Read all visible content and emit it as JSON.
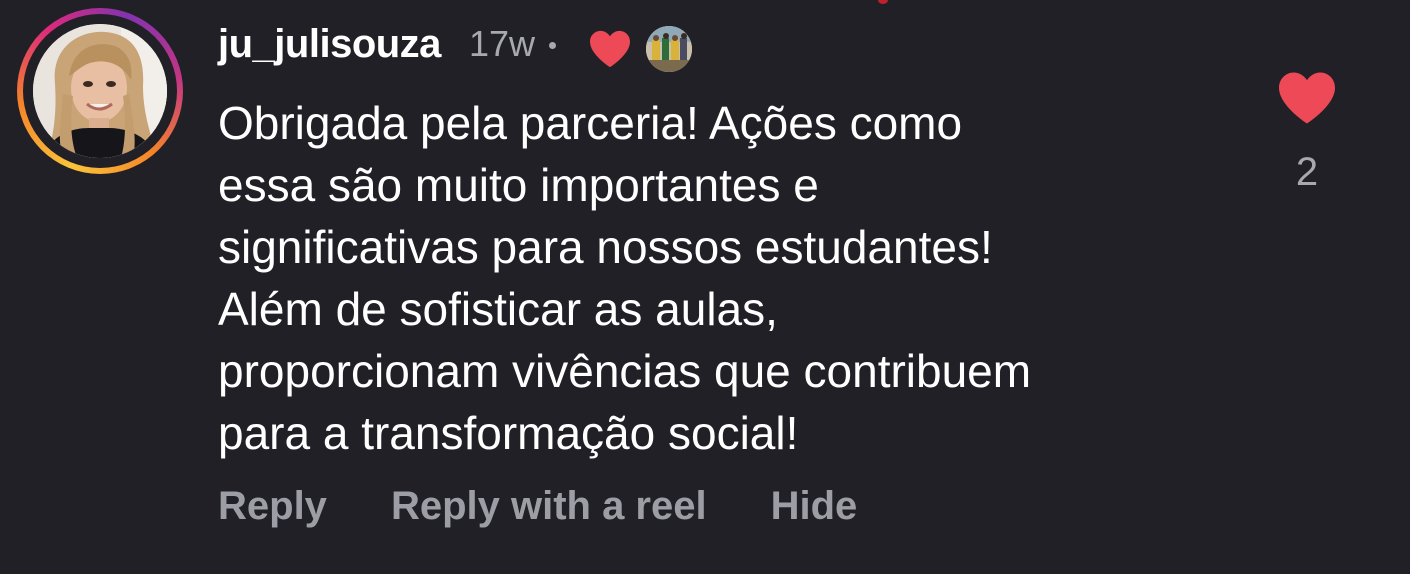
{
  "comment": {
    "username": "ju_julisouza",
    "timestamp": "17w",
    "separator": "•",
    "text": "Obrigada pela parceria! Ações como\nessa são muito importantes  e\nsignificativas para nossos estudantes!\nAlém de sofisticar as aulas,\nproporcionam vivências que contribuem\npara a transformação social!",
    "like_count": "2"
  },
  "actions": {
    "reply": "Reply",
    "reply_with_reel": "Reply with a reel",
    "hide": "Hide"
  },
  "colors": {
    "background": "#202026",
    "heart": "#ed4956",
    "muted_text": "#9d9da5"
  },
  "icons": {
    "creator_liked": "heart-icon",
    "like": "heart-icon"
  }
}
